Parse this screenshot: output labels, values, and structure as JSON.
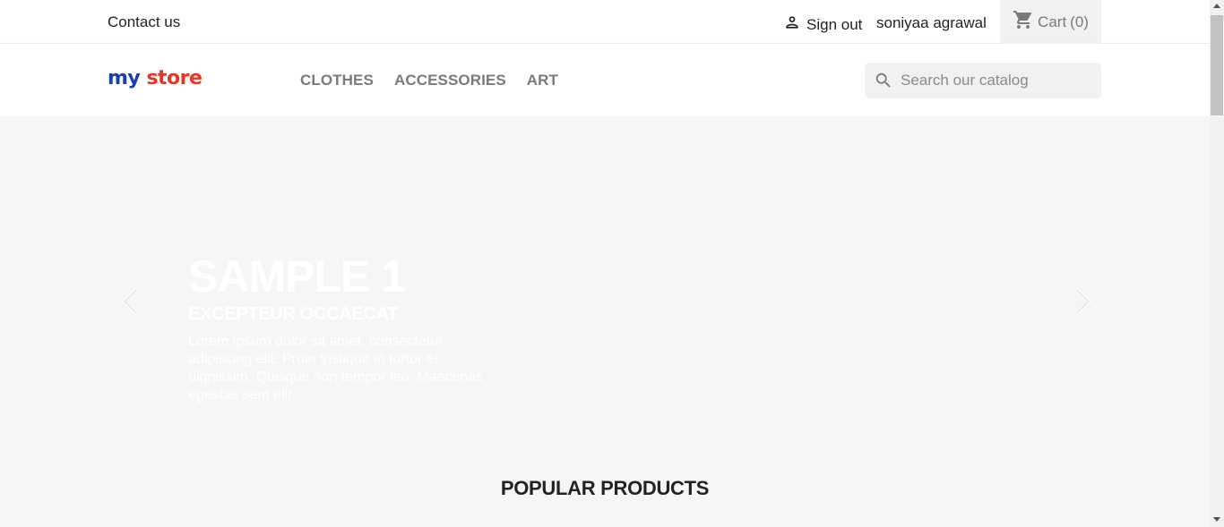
{
  "topbar": {
    "contact_label": "Contact us",
    "signout_label": "Sign out",
    "username": "soniyaa agrawal",
    "cart_label": "Cart",
    "cart_count": "(0)"
  },
  "header": {
    "logo": {
      "part1": "my",
      "part2": "store"
    },
    "nav": [
      {
        "label": "CLOTHES"
      },
      {
        "label": "ACCESSORIES"
      },
      {
        "label": "ART"
      }
    ],
    "search": {
      "placeholder": "Search our catalog"
    }
  },
  "carousel": {
    "title": "SAMPLE 1",
    "subtitle": "EXCEPTEUR OCCAECAT",
    "text": "Lorem ipsum dolor sit amet, consectetur adipiscing elit. Proin tristique in tortor et dignissim. Quisque non tempor leo. Maecenas egestas sem elit"
  },
  "section": {
    "popular_title": "POPULAR PRODUCTS"
  },
  "icons": {
    "user": "user-icon",
    "cart": "cart-icon",
    "search": "search-icon",
    "prev": "chevron-left-icon",
    "next": "chevron-right-icon"
  },
  "colors": {
    "accent_grey": "#7a7a7a",
    "background": "#f6f6f6"
  }
}
